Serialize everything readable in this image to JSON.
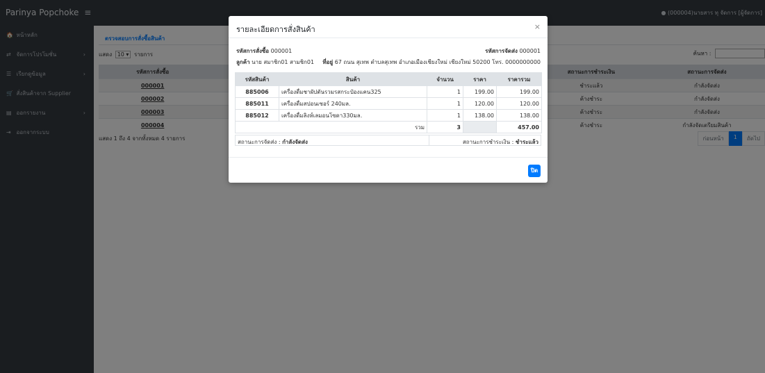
{
  "topbar": {
    "brand": "Parinya Popchoke",
    "menu_icon": "≡",
    "user_icon": "user-circle-icon",
    "user": "(000004)นายสาร ทุ จัดการ [ผู้จัดการ]"
  },
  "sidebar": {
    "items": [
      {
        "icon": "home-icon",
        "glyph": "🏠",
        "label": "หน้าหลัก",
        "chevron": ""
      },
      {
        "icon": "exchange-icon",
        "glyph": "⇄",
        "label": "จัดการโปรโมชั่น",
        "chevron": "›"
      },
      {
        "icon": "list-icon",
        "glyph": "☰",
        "label": "เรียกดูข้อมูล",
        "chevron": "›"
      },
      {
        "icon": "cart-icon",
        "glyph": "🛒",
        "label": "สั่งสินค้าจาก Supplier",
        "chevron": ""
      },
      {
        "icon": "chart-icon",
        "glyph": "▤",
        "label": "ออกรายงาน",
        "chevron": "›"
      },
      {
        "icon": "logout-icon",
        "glyph": "⇥",
        "label": "ออกจากระบบ",
        "chevron": ""
      }
    ]
  },
  "main": {
    "card_title": "ตรวจสอบการสั่งซื้อสินค้า",
    "length_prefix": "แสดง",
    "length_value": "10 ▾",
    "length_suffix": "รายการ",
    "search_label": "ค้นหา :",
    "columns": [
      "รหัสการสั่งซื้อ",
      "",
      "",
      "",
      "สถานะการชำระเงิน",
      "สถานะการจัดส่ง"
    ],
    "rows": [
      {
        "order_id": "000001",
        "payment": "ชำระแล้ว",
        "shipping": "กำลังจัดส่ง"
      },
      {
        "order_id": "000002",
        "payment": "ค้างชำระ",
        "shipping": "กำลังจัดส่ง"
      },
      {
        "order_id": "000003",
        "payment": "ค้างชำระ",
        "shipping": "กำลังจัดส่ง"
      },
      {
        "order_id": "000004",
        "payment": "ค้างชำระ",
        "shipping": "กำลังจัดเตรียมสินค้า"
      }
    ],
    "info": "แสดง 1 ถึง 4 จากทั้งหมด 4 รายการ",
    "pager": {
      "prev": "ก่อนหน้า",
      "current": "1",
      "next": "ถัดไป"
    }
  },
  "modal": {
    "title": "รายละเอียดการสั่งสินค้า",
    "close": "×",
    "order_label": "รหัสการสั่งซื้อ",
    "order_value": "000001",
    "shipment_label": "รหัสการจัดส่ง",
    "shipment_value": "000001",
    "customer_label": "ลูกค้า",
    "customer_value": "นาย สมาชิก01 สามชิก01",
    "address_label": "ที่อยู่",
    "address_value": "67 ถนน สุเทพ ตำบลสุเทพ อำเภอเมืองเชียงใหม่ เชียงใหม่ 50200 โทร. 0000000000",
    "columns": [
      "รหัสสินค้า",
      "สินค้า",
      "จำนวน",
      "ราคา",
      "ราคารวม"
    ],
    "items": [
      {
        "code": "885006",
        "name": "เครื่องดื่มชาผัปตันรวมรสกระป๋องแคน325",
        "qty": "1",
        "price": "199.00",
        "total": "199.00"
      },
      {
        "code": "885011",
        "name": "เครื่องดื่มสปอนเซอร์ 240มล.",
        "qty": "1",
        "price": "120.00",
        "total": "120.00"
      },
      {
        "code": "885012",
        "name": "เครื่องดื่มลิงห์เลมอนโซดา330มล.",
        "qty": "1",
        "price": "138.00",
        "total": "138.00"
      }
    ],
    "sum_label": "รวม",
    "sum_qty": "3",
    "sum_total": "457.00",
    "shipping_status_label": "สถานะการจัดส่ง :",
    "shipping_status_value": "กำลังจัดส่ง",
    "payment_status_label": "สถานะการชำระเงิน :",
    "payment_status_value": "ชำระแล้ว",
    "close_button": "ปิด"
  }
}
